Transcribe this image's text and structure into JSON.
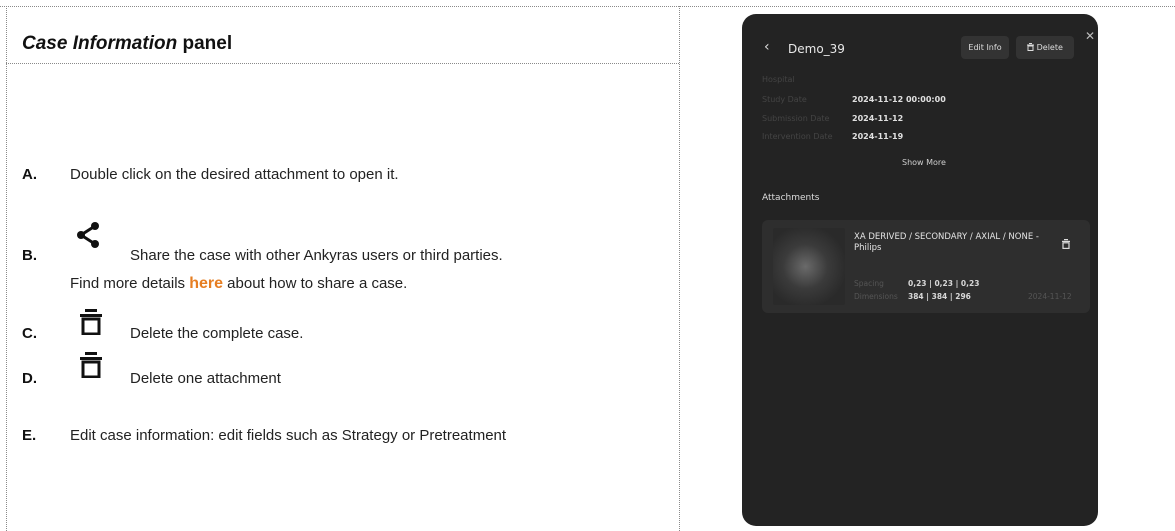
{
  "panel": {
    "title_italic": "Case Information",
    "title_rest": "panel"
  },
  "steps": [
    {
      "letter": "A.",
      "text": "Double click on the desired attachment to open it."
    },
    {
      "letter": "B.",
      "icon": "share-icon",
      "text": "Share the case with other Ankyras users or third parties.",
      "line2_pre": "Find more details ",
      "line2_link": "here",
      "line2_post": " about how to share a case."
    },
    {
      "letter": "C.",
      "icon": "trash-icon",
      "text": "Delete the complete case."
    },
    {
      "letter": "D.",
      "icon": "trash-icon",
      "text": "Delete one attachment"
    },
    {
      "letter": "E.",
      "text": "Edit case information: edit fields such as Strategy or Pretreatment"
    }
  ],
  "colors": {
    "link": "#e67e22",
    "phone_bg": "#232323"
  },
  "phone": {
    "back_icon": "chevron-left-icon",
    "case_name": "Demo_39",
    "edit_label": "Edit Info",
    "delete_label": "Delete",
    "close_icon": "close-icon",
    "fields": [
      {
        "label": "Hospital",
        "value": ""
      },
      {
        "label": "Study Date",
        "value": "2024-11-12 00:00:00"
      },
      {
        "label": "Submission Date",
        "value": "2024-11-12"
      },
      {
        "label": "Intervention Date",
        "value": "2024-11-19"
      }
    ],
    "show_more": "Show More",
    "attachments_heading": "Attachments",
    "attachment": {
      "title": "XA DERIVED / SECONDARY / AXIAL / NONE - Philips",
      "spacing_label": "Spacing",
      "spacing_value": "0,23 | 0,23 | 0,23",
      "dimensions_label": "Dimensions",
      "dimensions_value": "384 | 384 | 296",
      "date": "2024-11-12"
    }
  }
}
